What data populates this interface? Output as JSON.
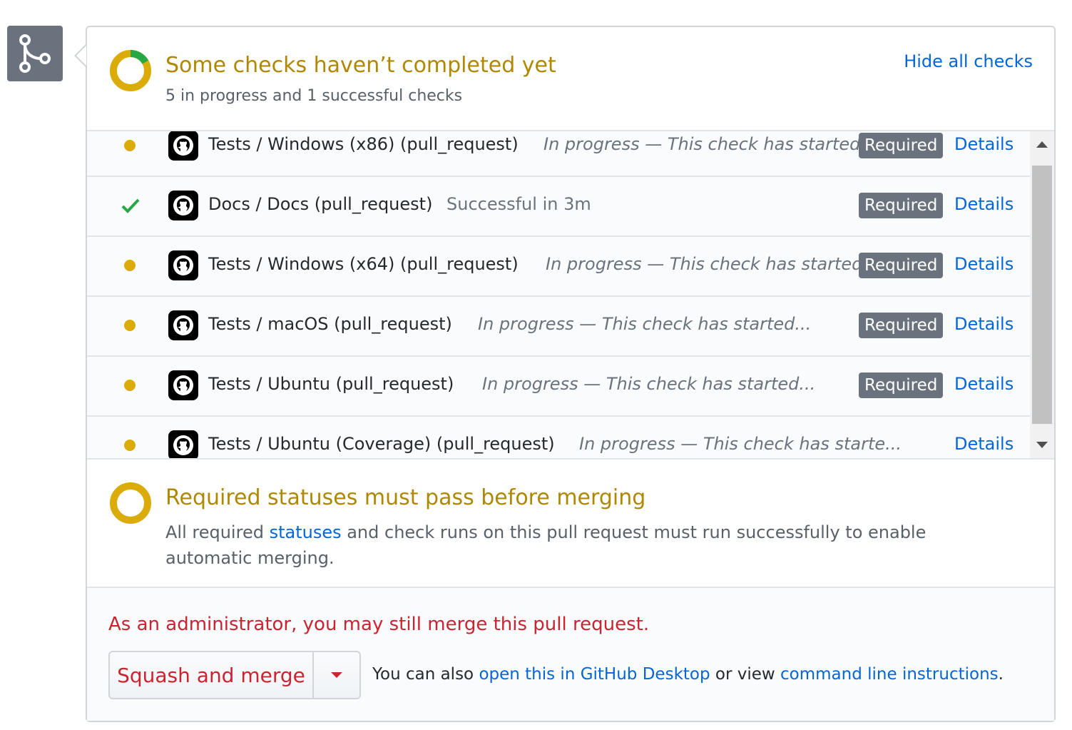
{
  "header": {
    "title": "Some checks haven’t completed yet",
    "subtitle": "5 in progress and 1 successful checks",
    "hide_link": "Hide all checks",
    "progress_fraction": 0.1667
  },
  "checks": [
    {
      "status": "in-progress",
      "name": "Tests / Windows (x86) (pull_request)",
      "description": "In progress — This check has started...",
      "required": "Required",
      "details": "Details"
    },
    {
      "status": "success",
      "name": "Docs / Docs (pull_request)",
      "description": "Successful in 3m",
      "required": "Required",
      "details": "Details"
    },
    {
      "status": "in-progress",
      "name": "Tests / Windows (x64) (pull_request)",
      "description": "In progress — This check has started...",
      "required": "Required",
      "details": "Details"
    },
    {
      "status": "in-progress",
      "name": "Tests / macOS (pull_request)",
      "description": "In progress — This check has started...",
      "required": "Required",
      "details": "Details"
    },
    {
      "status": "in-progress",
      "name": "Tests / Ubuntu (pull_request)",
      "description": "In progress — This check has started...",
      "required": "Required",
      "details": "Details"
    },
    {
      "status": "in-progress",
      "name": "Tests / Ubuntu (Coverage) (pull_request)",
      "description": "In progress — This check has starte...",
      "required": "",
      "details": "Details"
    }
  ],
  "required_section": {
    "title": "Required statuses must pass before merging",
    "text_before": "All required ",
    "link": "statuses",
    "text_after": " and check runs on this pull request must run successfully to enable automatic merging."
  },
  "admin": {
    "notice": "As an administrator, you may still merge this pull request.",
    "merge_button": "Squash and merge",
    "also_prefix": "You can also ",
    "desktop_link": "open this in GitHub Desktop",
    "middle": " or view ",
    "cli_link": "command line instructions",
    "suffix": "."
  },
  "colors": {
    "pending": "#dbab09",
    "success": "#28a745",
    "link": "#0366d6",
    "danger": "#cb2431",
    "title_warning": "#b08800"
  },
  "icons": {
    "merge_badge": "git-merge-icon",
    "check_logo": "github-mark-icon",
    "success": "checkmark-icon",
    "pending": "dot-icon"
  }
}
